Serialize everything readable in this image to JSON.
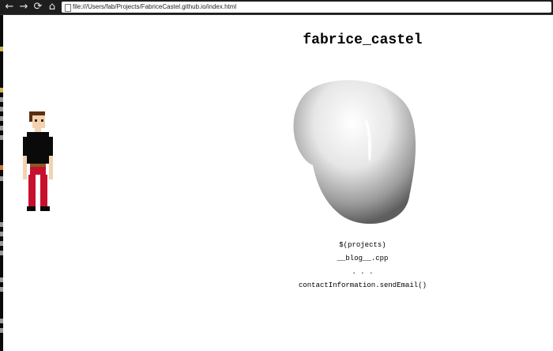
{
  "browser": {
    "url": "file:///Users/fab/Projects/FabriceCastel.github.io/index.html",
    "back_icon": "←",
    "forward_icon": "→",
    "reload_icon": "⟳",
    "home_icon": "⌂"
  },
  "page": {
    "title": "fabrice_castel",
    "menu": [
      "$(projects)",
      "__blog__.cpp",
      ". . .",
      "contactInformation.sendEmail()"
    ]
  }
}
